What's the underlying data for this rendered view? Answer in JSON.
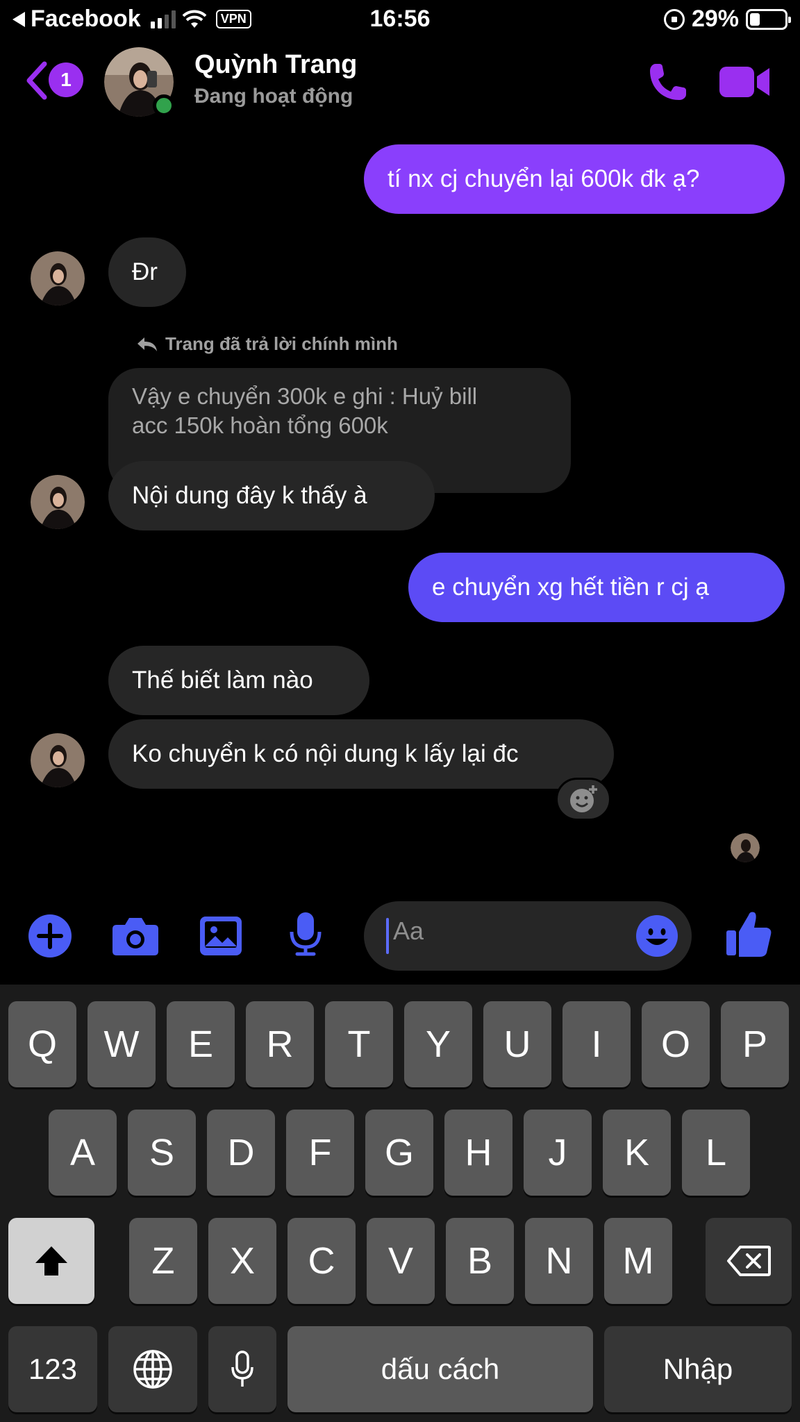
{
  "status_bar": {
    "back_app": "Facebook",
    "vpn": "VPN",
    "time": "16:56",
    "battery_percent": "29%",
    "battery_level": 0.29
  },
  "header": {
    "unread_count": "1",
    "contact_name": "Quỳnh Trang",
    "contact_status": "Đang hoạt động",
    "online": true
  },
  "messages": [
    {
      "from": "me",
      "text": "tí nx cj chuyển lại 600k đk ạ?"
    },
    {
      "from": "them",
      "text": "Đr"
    },
    {
      "reply_note": "Trang đã trả lời chính mình",
      "quoted_line1": "Vậy e chuyển 300k e ghi : Huỷ bill",
      "quoted_line2": "acc 150k hoàn tổng 600k",
      "from": "them",
      "text": "Nội dung đây k thấy à"
    },
    {
      "from": "me",
      "text": "e chuyển xg hết tiền r cj ạ"
    },
    {
      "from": "them",
      "text": "Thế biết làm nào"
    },
    {
      "from": "them",
      "text": "Ko chuyển k có nội dung k lấy lại đc"
    }
  ],
  "composer": {
    "placeholder": "Aa"
  },
  "keyboard": {
    "row1": [
      "Q",
      "W",
      "E",
      "R",
      "T",
      "Y",
      "U",
      "I",
      "O",
      "P"
    ],
    "row2": [
      "A",
      "S",
      "D",
      "F",
      "G",
      "H",
      "J",
      "K",
      "L"
    ],
    "row3": [
      "Z",
      "X",
      "C",
      "V",
      "B",
      "N",
      "M"
    ],
    "numbers_key": "123",
    "space_key": "dấu cách",
    "return_key": "Nhập"
  },
  "colors": {
    "outgoing_bubble": "#8a3ffc",
    "outgoing_bubble_blue": "#5c4bf5",
    "incoming_bubble": "#262626",
    "accent": "#9a2ff0",
    "composer_icons": "#4a5cf5"
  }
}
